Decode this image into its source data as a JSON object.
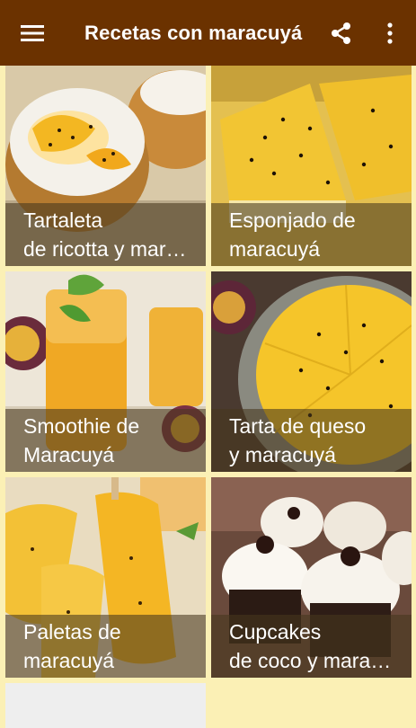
{
  "app_bar": {
    "title": "Recetas con maracuyá",
    "menu_icon": "hamburger-menu-icon",
    "share_icon": "share-icon",
    "more_icon": "more-vertical-icon",
    "background": "#6b3200"
  },
  "recipes": [
    {
      "line1": "Tartaleta",
      "line2": "de ricotta y maracuyá"
    },
    {
      "line1": "Esponjado de",
      "line2": "maracuyá"
    },
    {
      "line1": "Smoothie de",
      "line2": "Maracuyá"
    },
    {
      "line1": "Tarta de queso",
      "line2": "y maracuyá"
    },
    {
      "line1": "Paletas de",
      "line2": "maracuyá"
    },
    {
      "line1": "Cupcakes",
      "line2": "de coco y maracuyá"
    }
  ],
  "colors": {
    "page_background": "#fbf0b5",
    "caption_overlay": "rgba(70,55,30,0.58)"
  }
}
